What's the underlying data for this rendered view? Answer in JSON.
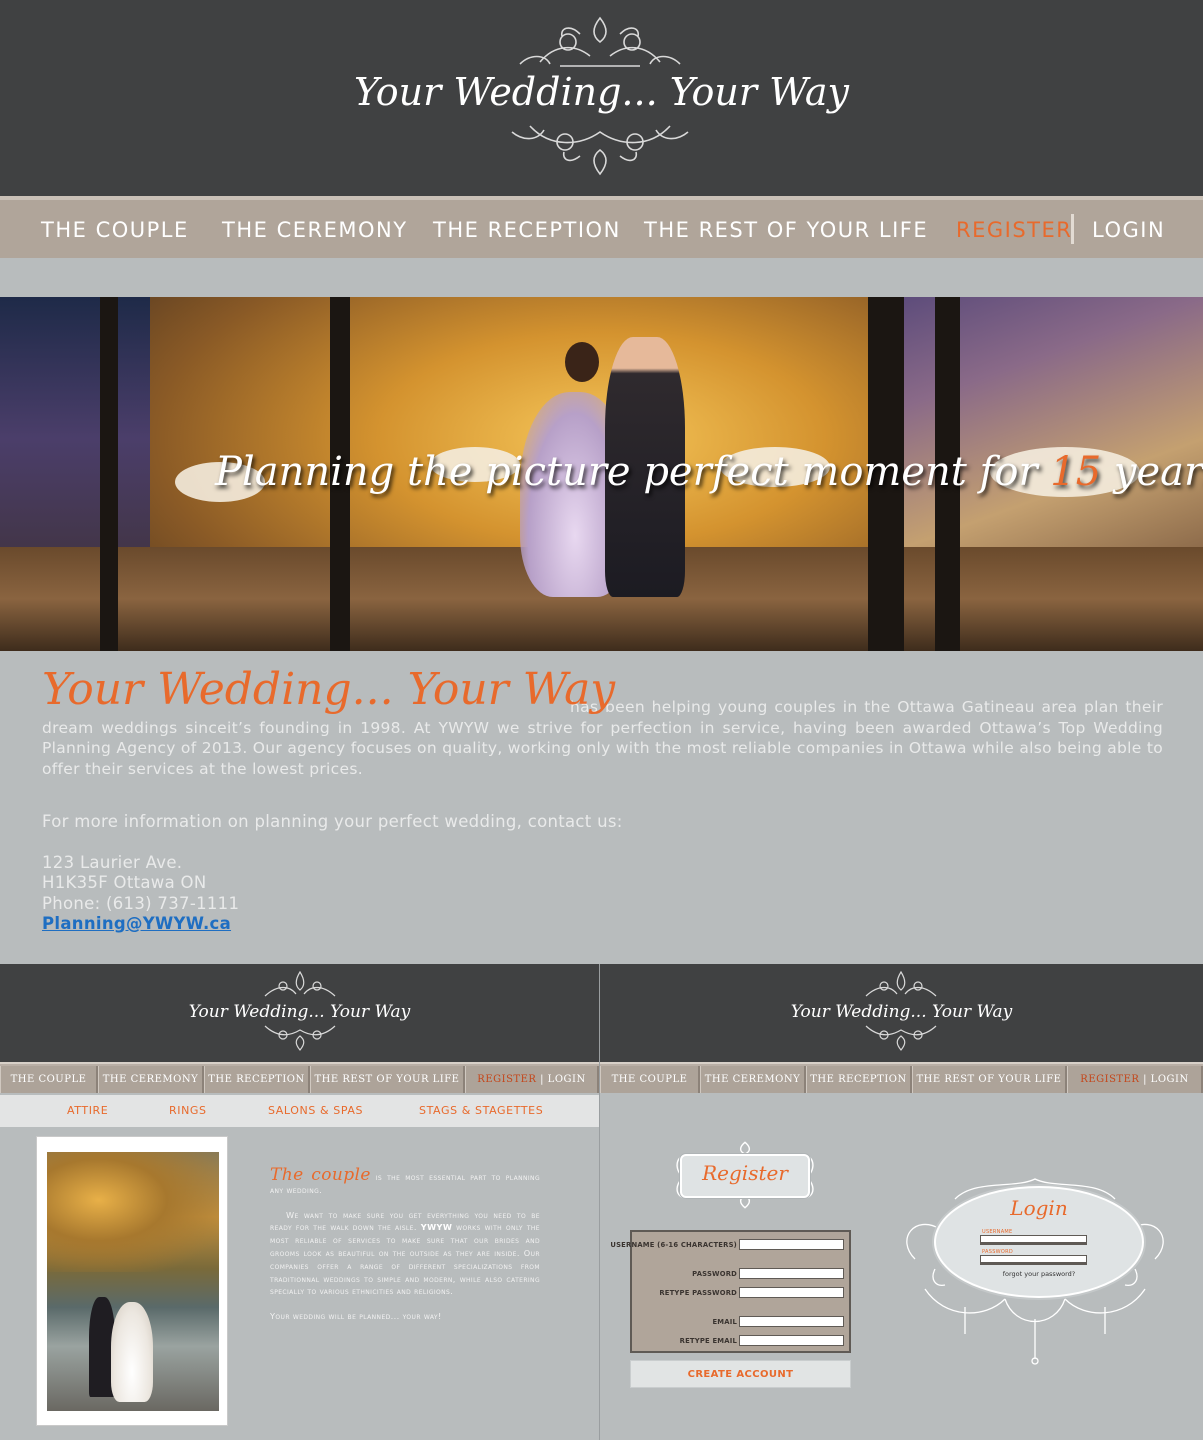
{
  "brand": {
    "logo_text": "Your Wedding... Your Way"
  },
  "nav": {
    "items": [
      "THE COUPLE",
      "THE CEREMONY",
      "THE RECEPTION",
      "THE REST OF YOUR LIFE"
    ],
    "register": "REGISTER",
    "login": "LOGIN"
  },
  "hero": {
    "tagline_before": "Planning the picture perfect moment for",
    "tagline_number": "15",
    "tagline_after": "years."
  },
  "intro": {
    "brand": "Your Wedding... Your Way",
    "paragraph": "has been helping young couples in the Ottawa Gatineau area plan their dream weddings sinceit’s founding in 1998. At YWYW we strive for perfection in service, having been awarded Ottawa’s Top Wedding Planning Agency of 2013. Our agency focuses on quality, working only with the most reliable companies in Ottawa while also being able to offer their services at the lowest prices."
  },
  "contact": {
    "lead": "For more information on planning your perfect wedding, contact us:",
    "address1": "123 Laurier Ave.",
    "address2": "H1K35F Ottawa ON",
    "phone": "Phone: (613) 737-1111",
    "email": "Planning@YWYW.ca"
  },
  "thumb_nav": {
    "items": [
      "THE COUPLE",
      "THE CEREMONY",
      "THE RECEPTION",
      "THE REST OF YOUR LIFE"
    ],
    "register": "REGISTER",
    "login": "LOGIN"
  },
  "couple_page": {
    "subnav": [
      "ATTIRE",
      "RINGS",
      "SALONS & SPAS",
      "STAGS & STAGETTES"
    ],
    "title": "The couple",
    "p1_rest": "is the most essential part to planning any wedding.",
    "p2_a": "We want to make sure you get everything you need to be ready for the walk down the aisle.",
    "p2_hl": "YWYW",
    "p2_b": "works with only the most reliable of services to make sure that our brides and grooms look as beautiful on the outside as they are inside. Our companies offer a range of different specializations from traditionnal weddings to simple and modern, while also catering specially to various ethnicities and religions.",
    "p3": "Your wedding will be planned... your way!"
  },
  "register_page": {
    "title": "Register",
    "labels": [
      "USERNAME (6-16 CHARACTERS)",
      "PASSWORD",
      "RETYPE PASSWORD",
      "EMAIL",
      "RETYPE EMAIL"
    ],
    "button": "CREATE ACCOUNT",
    "login_title": "Login",
    "login_user_label": "USERNAME",
    "login_pass_label": "PASSWORD",
    "forgot": "forgot your password?"
  },
  "colors": {
    "accent": "#e86a2c",
    "header_bg": "#404142",
    "nav_bg": "#b0a59a",
    "page_bg": "#b8bcbd"
  }
}
